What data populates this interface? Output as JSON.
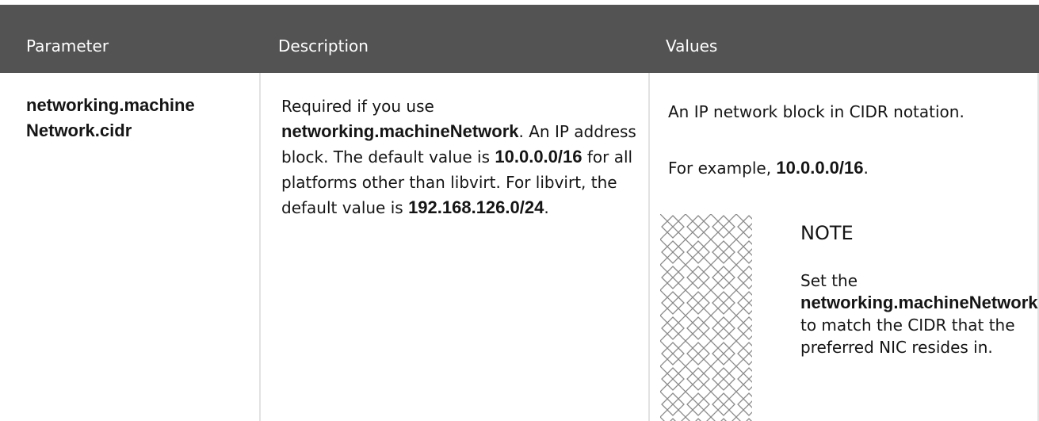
{
  "table": {
    "headers": [
      "Parameter",
      "Description",
      "Values"
    ],
    "row": {
      "parameter": "networking.machine Network.cidr",
      "description": {
        "t1": "Required if you use ",
        "b1": "networking.machineNetwork",
        "t2": ". An IP address block. The default value is ",
        "b2": "10.0.0.0/16",
        "t3": " for all platforms other than libvirt. For libvirt, the default value is ",
        "b3": "192.168.126.0/24",
        "t4": "."
      },
      "values": {
        "p1": "An IP network block in CIDR notation.",
        "p2_prefix": "For example, ",
        "p2_bold": "10.0.0.0/16",
        "p2_suffix": "."
      },
      "note": {
        "icon": "note-pattern-icon",
        "title": "NOTE",
        "t1": "Set the ",
        "b1": "networking.machineNetwork",
        "t2": " to match the CIDR that the preferred NIC resides in."
      }
    }
  },
  "colors": {
    "header_bg": "#535353",
    "header_text": "#ffffff",
    "divider": "#e2e2e2",
    "icon_stroke": "#8a8a8a"
  }
}
